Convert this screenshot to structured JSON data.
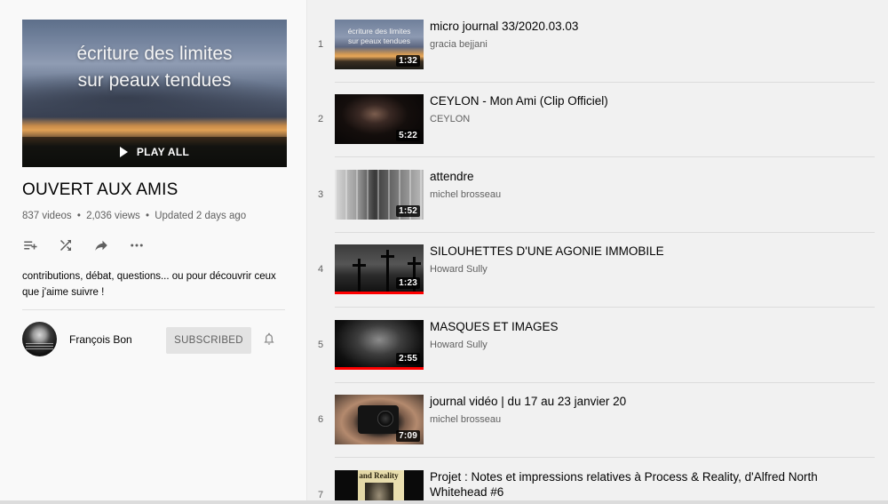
{
  "playlist": {
    "hero_title_line1": "écriture des limites",
    "hero_title_line2": "sur peaux tendues",
    "play_all_label": "PLAY ALL",
    "title": "OUVERT AUX AMIS",
    "video_count": "837 videos",
    "views": "2,036 views",
    "updated": "Updated 2 days ago",
    "stats_separator": "•",
    "description": "contributions, débat, questions... ou pour découvrir ceux que j'aime suivre !",
    "actions": [
      {
        "name": "add-to-queue-icon"
      },
      {
        "name": "shuffle-icon"
      },
      {
        "name": "share-icon"
      },
      {
        "name": "more-icon"
      }
    ]
  },
  "owner": {
    "name": "François Bon",
    "subscribe_label": "SUBSCRIBED",
    "bell_icon": "bell-icon"
  },
  "videos": [
    {
      "index": "1",
      "title": "micro journal 33/2020.03.03",
      "channel": "gracia bejjani",
      "duration": "1:32",
      "thumb_text_1": "écriture des limites",
      "thumb_text_2": "sur peaux tendues"
    },
    {
      "index": "2",
      "title": "CEYLON - Mon Ami (Clip Officiel)",
      "channel": "CEYLON",
      "duration": "5:22"
    },
    {
      "index": "3",
      "title": "attendre",
      "channel": "michel brosseau",
      "duration": "1:52"
    },
    {
      "index": "4",
      "title": "SILOUHETTES D'UNE AGONIE IMMOBILE",
      "channel": "Howard Sully",
      "duration": "1:23",
      "watched_fraction": 1.0
    },
    {
      "index": "5",
      "title": "MASQUES ET IMAGES",
      "channel": "Howard Sully",
      "duration": "2:55",
      "watched_fraction": 1.0
    },
    {
      "index": "6",
      "title": "journal vidéo | du 17 au 23 janvier 20",
      "channel": "michel brosseau",
      "duration": "7:09"
    },
    {
      "index": "7",
      "title": "Projet : Notes et impressions relatives à Process & Reality, d'Alfred North Whitehead #6",
      "channel": "",
      "duration": "",
      "thumb_text_1": "and Reality"
    }
  ],
  "colors": {
    "progress": "#ff0000",
    "subscribed_bg": "#e3e3e3",
    "secondary_text": "#606060"
  }
}
